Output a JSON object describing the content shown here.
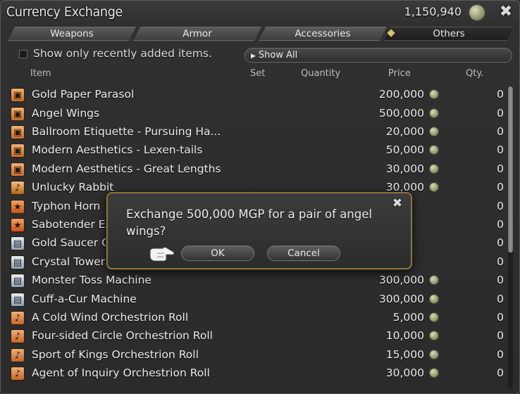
{
  "window": {
    "title": "Currency Exchange",
    "currency_amount": "1,150,940",
    "close_icon": "close-x-icon"
  },
  "tabs": [
    {
      "label": "Weapons",
      "active": false
    },
    {
      "label": "Armor",
      "active": false
    },
    {
      "label": "Accessories",
      "active": false
    },
    {
      "label": "Others",
      "active": true
    }
  ],
  "filter": {
    "checkbox_label": "Show only recently added items.",
    "checkbox_checked": false,
    "dropdown_value": "Show All"
  },
  "columns": {
    "item": "Item",
    "set": "Set",
    "quantity": "Quantity",
    "price": "Price",
    "qty": "Qty."
  },
  "items": [
    {
      "icon": "chest-icon",
      "name": "Gold Paper Parasol",
      "price": "200,000",
      "qty": "0"
    },
    {
      "icon": "chest-icon",
      "name": "Angel Wings",
      "price": "500,000",
      "qty": "0"
    },
    {
      "icon": "chest-icon",
      "name": "Ballroom Etiquette - Pursuing Ha...",
      "price": "20,000",
      "qty": "0"
    },
    {
      "icon": "chest-icon",
      "name": "Modern Aesthetics - Lexen-tails",
      "price": "50,000",
      "qty": "0"
    },
    {
      "icon": "chest-icon",
      "name": "Modern Aesthetics - Great Lengths",
      "price": "30,000",
      "qty": "0"
    },
    {
      "icon": "horn-icon",
      "name": "Unlucky Rabbit",
      "price": "30,000",
      "qty": "0"
    },
    {
      "icon": "star-icon",
      "name": "Typhon Horn",
      "price": "",
      "qty": "0"
    },
    {
      "icon": "star-icon",
      "name": "Sabotender E",
      "price": "",
      "qty": "0"
    },
    {
      "icon": "machine-icon",
      "name": "Gold Saucer C",
      "price": "",
      "qty": "0"
    },
    {
      "icon": "machine-icon",
      "name": "Crystal Tower",
      "price": "",
      "qty": "0"
    },
    {
      "icon": "machine-icon",
      "name": "Monster Toss Machine",
      "price": "300,000",
      "qty": "0"
    },
    {
      "icon": "machine-icon",
      "name": "Cuff-a-Cur Machine",
      "price": "300,000",
      "qty": "0"
    },
    {
      "icon": "music-note-icon",
      "name": "A Cold Wind Orchestrion Roll",
      "price": "5,000",
      "qty": "0"
    },
    {
      "icon": "music-note-icon",
      "name": "Four-sided Circle Orchestrion Roll",
      "price": "10,000",
      "qty": "0"
    },
    {
      "icon": "music-note-icon",
      "name": "Sport of Kings Orchestrion Roll",
      "price": "15,000",
      "qty": "0"
    },
    {
      "icon": "music-note-icon",
      "name": "Agent of Inquiry Orchestrion Roll",
      "price": "30,000",
      "qty": "0"
    }
  ],
  "dialog": {
    "message": "Exchange 500,000 MGP for a pair of angel wings?",
    "ok_label": "OK",
    "cancel_label": "Cancel"
  },
  "colors": {
    "accent_gold": "#8a7440",
    "coin": "#9ea27a"
  }
}
